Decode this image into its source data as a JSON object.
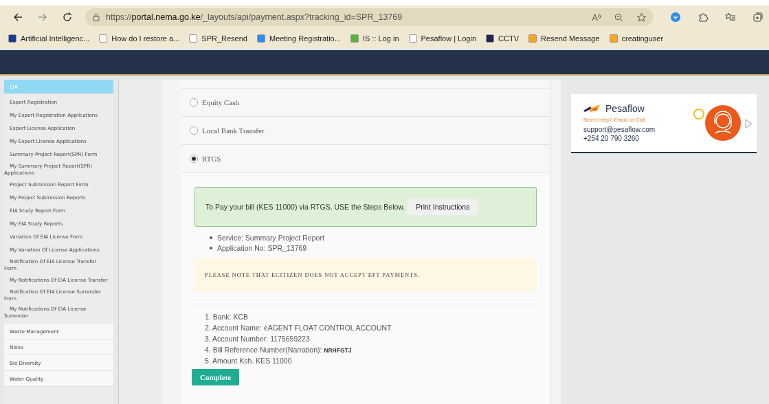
{
  "browser": {
    "url_prefix": "https://",
    "url_host": "portal.nema.go.ke",
    "url_path": "/_layouts/api/payment.aspx?tracking_id=SPR_13769",
    "bookmarks": [
      {
        "label": "Artificial Intelligenc..."
      },
      {
        "label": "How do I restore a..."
      },
      {
        "label": "SPR_Resend"
      },
      {
        "label": "Meeting Registratio..."
      },
      {
        "label": "IS :: Log in"
      },
      {
        "label": "Pesaflow | Login"
      },
      {
        "label": "CCTV"
      },
      {
        "label": "Resend Message"
      },
      {
        "label": "creatinguser"
      }
    ]
  },
  "sidebar": {
    "sections": [
      {
        "label": "EIA",
        "selected": true,
        "children": [
          {
            "label": "Expert Registration"
          },
          {
            "label": "My Expert Registration Applications"
          },
          {
            "label": "Expert License Application"
          },
          {
            "label": "My Expert License Applications"
          },
          {
            "label": "Summary Project Report(SPR) Form"
          },
          {
            "label": "My Summary Project Report(SPR) Applications"
          },
          {
            "label": "Project Submission Report Form"
          },
          {
            "label": "My Project Submission Reports"
          },
          {
            "label": "EIA Study Report Form"
          },
          {
            "label": "My EIA Study Reports"
          },
          {
            "label": "Variation Of EIA License Form"
          },
          {
            "label": "My Variation Of License Applications"
          },
          {
            "label": "Notification Of EIA License Transfer Form"
          },
          {
            "label": "My Notifications Of EIA License Transfer"
          },
          {
            "label": "Notification Of EIA License Surrender Form"
          },
          {
            "label": "My Notifications Of EIA License Surrender"
          }
        ]
      },
      {
        "label": "Waste Management",
        "selected": false
      },
      {
        "label": "Noise",
        "selected": false
      },
      {
        "label": "Bio Diversity",
        "selected": false
      },
      {
        "label": "Water Quality",
        "selected": false
      }
    ]
  },
  "payment_options": [
    {
      "label": "Equity Cash",
      "selected": false
    },
    {
      "label": "Local Bank Transfer",
      "selected": false
    },
    {
      "label": "RTGS",
      "selected": true
    }
  ],
  "instructions": {
    "message": "To Pay your bill (KES 11000) via RTGS. USE the Steps Below.",
    "print_button": "Print Instructions",
    "details": [
      "Service: Summary Project Report",
      "Application No: SPR_13769"
    ],
    "note": "PLEASE NOTE THAT ECITIZEN DOES NOT ACCEPT EFT PAYMENTS.",
    "steps": [
      "1. Bank: KCB",
      "2. Account Name: eAGENT FLOAT CONTROL ACCOUNT",
      "3. Account Number: 1175659223",
      "4. Bill Reference Number(Narration): **NRHFGTJ**",
      "5. Amount Ksh. KES 11000"
    ],
    "complete_button": "Complete"
  },
  "support": {
    "brand": "Pesaflow",
    "tagline": "Need Help? Email or Call",
    "email": "support@pesaflow.com",
    "phone": "+254 20 790 3260"
  }
}
